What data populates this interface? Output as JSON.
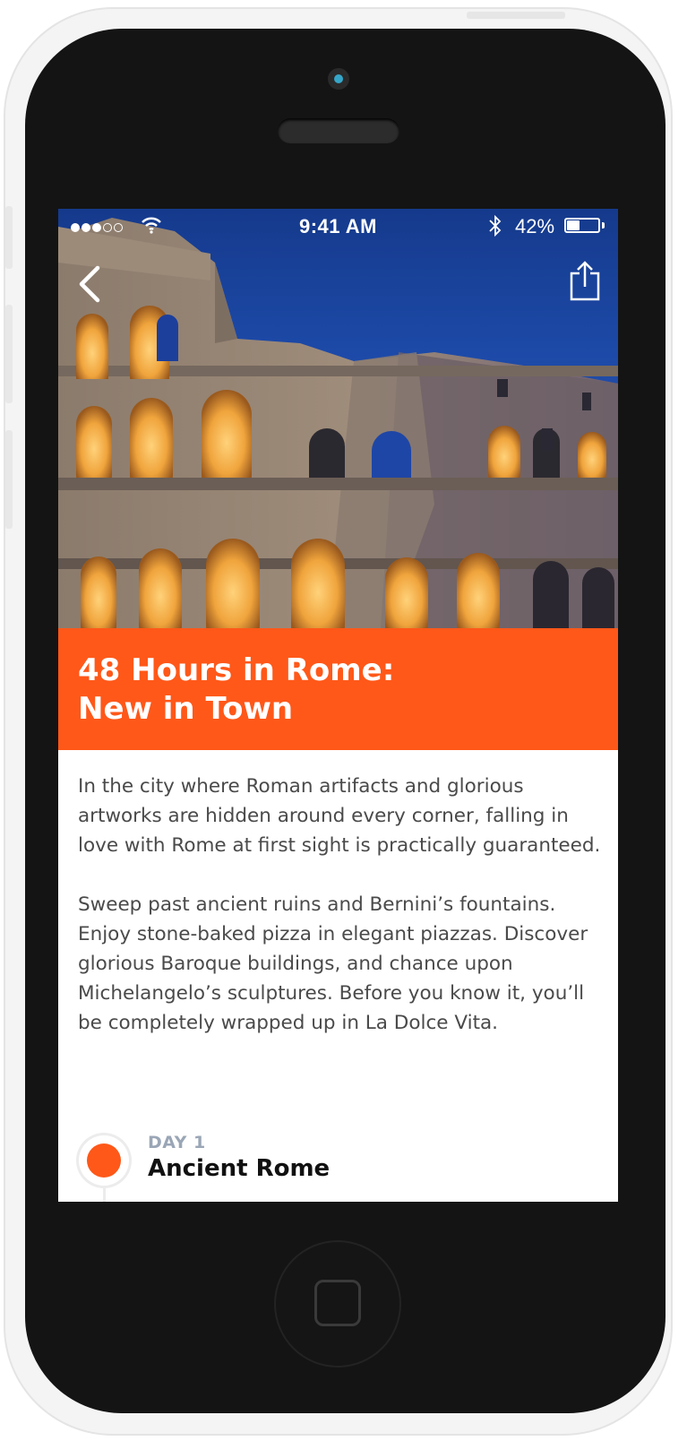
{
  "status_bar": {
    "time": "9:41 AM",
    "battery_percent": "42%",
    "battery_level": 0.42,
    "signal_bars_filled": 3,
    "signal_bars_total": 5
  },
  "nav": {
    "back_icon": "chevron-left-icon",
    "share_icon": "share-icon"
  },
  "hero": {
    "image": "colosseum-at-dusk"
  },
  "article": {
    "title_line1": "48 Hours in Rome:",
    "title_line2": "New in Town",
    "paragraphs": [
      "In the city where Roman artifacts and glorious artworks are hidden around every corner, falling in love with Rome at first sight is practically guaranteed.",
      "Sweep past ancient ruins and Bernini’s fountains. Enjoy stone-baked pizza in elegant piazzas. Discover glorious Baroque buildings, and chance upon Michelangelo’s sculptures. Before you know it, you’ll be completely wrapped up in La Dolce Vita."
    ]
  },
  "itinerary": {
    "items": [
      {
        "day_label": "DAY 1",
        "title": "Ancient Rome"
      }
    ]
  },
  "colors": {
    "accent": "#ff5819",
    "body_text": "#4a4a4a",
    "day_label": "#9aa6b6"
  }
}
